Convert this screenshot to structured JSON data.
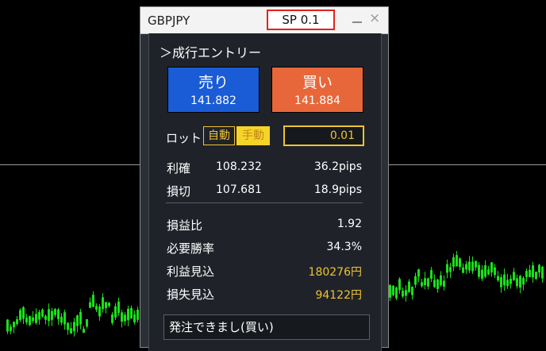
{
  "window": {
    "title": "GBPJPY",
    "spread": "SP 0.1",
    "minimize_icon": "minimize-icon",
    "close_icon": "close-icon",
    "close_glyph": "×"
  },
  "entry": {
    "header": "＞成行エントリー",
    "sell": {
      "label": "売り",
      "price": "141.882"
    },
    "buy": {
      "label": "買い",
      "price": "141.884"
    }
  },
  "lot": {
    "label": "ロット",
    "auto_label": "自動",
    "manual_label": "手動",
    "value": "0.01"
  },
  "levels": [
    {
      "label": "利確",
      "price": "108.232",
      "pips": "36.2pips"
    },
    {
      "label": "損切",
      "price": "107.681",
      "pips": "18.9pips"
    }
  ],
  "stats": [
    {
      "label": "損益比",
      "value": "1.92"
    },
    {
      "label": "必要勝率",
      "value": "34.3%"
    },
    {
      "label": "利益見込",
      "value": "180276円"
    },
    {
      "label": "損失見込",
      "value": "94122円"
    }
  ],
  "status": "発注できまし(買い)",
  "colors": {
    "sell": "#1a5bd6",
    "buy": "#e8673a",
    "accent_gold": "#f0c233",
    "spread_border": "#e0231c",
    "candle": "#19e019"
  }
}
